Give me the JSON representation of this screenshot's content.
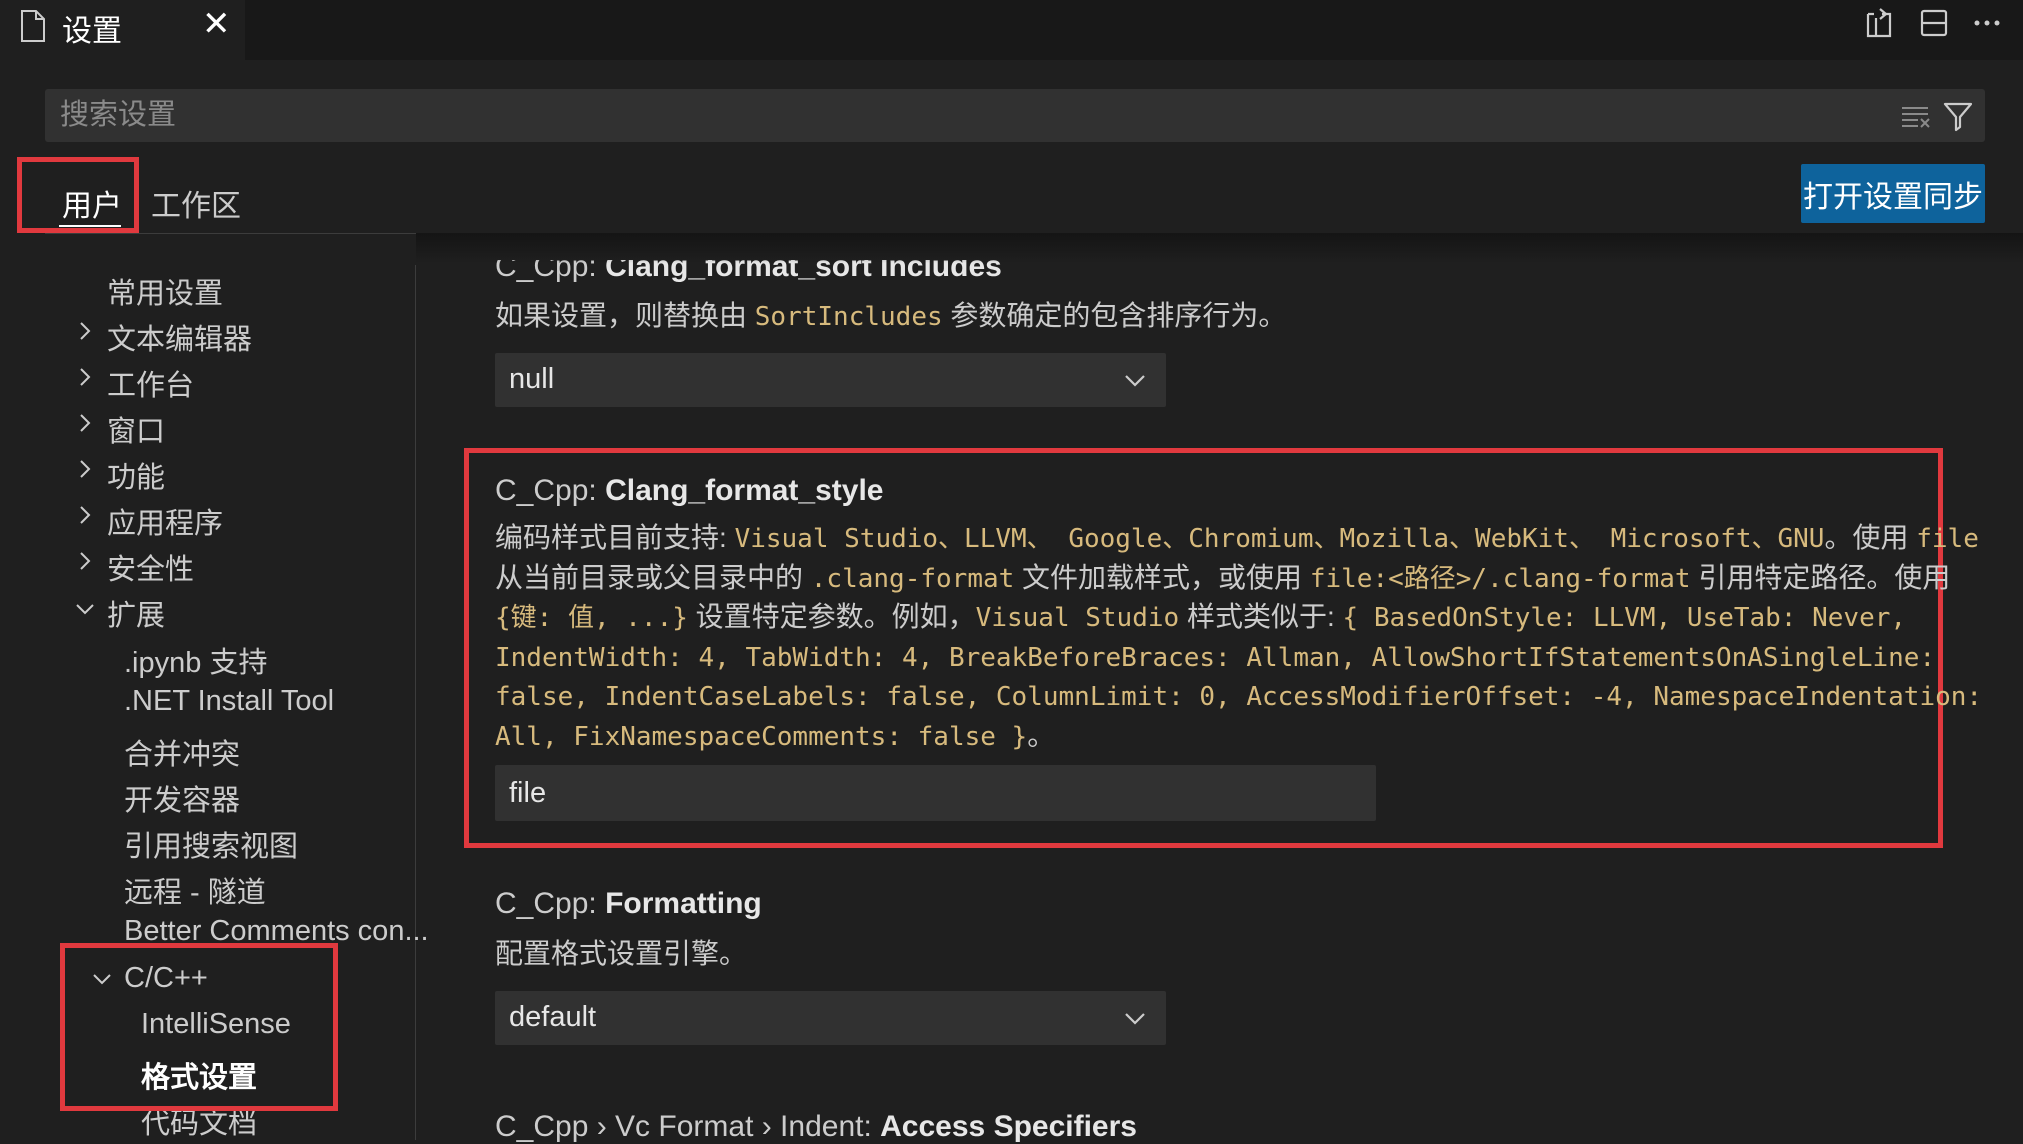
{
  "tab": {
    "title": "设置",
    "close": "✕"
  },
  "search": {
    "placeholder": "搜索设置"
  },
  "scope_tabs": {
    "user": "用户",
    "workspace": "工作区"
  },
  "sync_button": "打开设置同步",
  "toc": {
    "common": "常用设置",
    "text_editor": "文本编辑器",
    "workbench": "工作台",
    "window": "窗口",
    "features": "功能",
    "application": "应用程序",
    "security": "安全性",
    "extensions": "扩展",
    "ipynb": ".ipynb 支持",
    "dotnet": ".NET Install Tool",
    "merge": "合并冲突",
    "devcontainer": "开发容器",
    "refsearch": "引用搜索视图",
    "remote": "远程 - 隧道",
    "better_comments": "Better Comments con...",
    "cpp": "C/C++",
    "intellisense": "IntelliSense",
    "formatting": "格式设置",
    "code_docs": "代码文档"
  },
  "settings": {
    "sort_includes": {
      "prefix": "C_Cpp: ",
      "name": "Clang_format_sort Includes",
      "desc_before": "如果设置，则替换由 ",
      "desc_code": "SortIncludes",
      "desc_after": " 参数确定的包含排序行为。",
      "value": "null"
    },
    "format_style": {
      "prefix": "C_Cpp: ",
      "name": "Clang_format_style",
      "l1_a": "编码样式目前支持: ",
      "l1_b": "Visual Studio、LLVM、 Google、Chromium、Mozilla、WebKit、 Microsoft、GNU",
      "l1_c": "。使用 ",
      "l1_d": "file",
      "l2_a": "从当前目录或父目录中的 ",
      "l2_b": ".clang-format",
      "l2_c": " 文件加载样式，或使用 ",
      "l2_d": "file:<路径>/.clang-format",
      "l2_e": " 引用特定路径。使用",
      "l3_a": "{键: 值, ...}",
      "l3_b": " 设置特定参数。例如，",
      "l3_c": "Visual Studio",
      "l3_d": " 样式类似于: ",
      "l3_e": "{ BasedOnStyle: LLVM, UseTab: Never,",
      "l4": "IndentWidth: 4, TabWidth: 4, BreakBeforeBraces: Allman, AllowShortIfStatementsOnASingleLine:",
      "l5": "false, IndentCaseLabels: false, ColumnLimit: 0, AccessModifierOffset: -4, NamespaceIndentation:",
      "l6_a": "All, FixNamespaceComments: false }",
      "l6_b": "。",
      "value": "file"
    },
    "formatting": {
      "prefix": "C_Cpp: ",
      "name": "Formatting",
      "desc": "配置格式设置引擎。",
      "value": "default"
    },
    "vc_indent": {
      "prefix": "C_Cpp › Vc Format › Indent: ",
      "name": "Access Specifiers"
    }
  },
  "icons": {
    "tab": "file-icon",
    "actions": [
      "open-json-icon",
      "split-editor-icon",
      "more-actions-icon"
    ],
    "search": [
      "clear-filter-icon",
      "filter-icon"
    ]
  },
  "colors": {
    "highlight": "#e0393e",
    "accent": "#0e639c",
    "code": "#d7ba7d"
  }
}
